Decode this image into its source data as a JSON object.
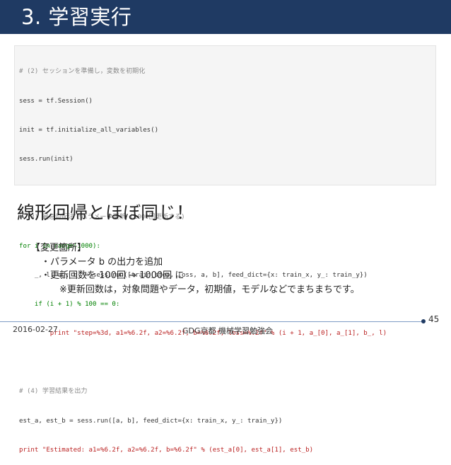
{
  "slide": {
    "title": "3. 学習実行",
    "heading": "線形回帰とほぼ同じ！",
    "notes": [
      "【変更箇所】",
      "・パラメータ b の出力を追加",
      "・更新回数を 100回 → 1000回 に",
      "※更新回数は，対象問題やデータ，初期値，モデルなどでまちまちです。"
    ],
    "footer": {
      "date": "2016-02-27",
      "event": "GDG京都 機械学習勉強会",
      "page": "45"
    }
  },
  "code": {
    "comment1": "# (2) セッションを準備し，変数を初期化",
    "line1": "sess = tf.Session()",
    "line2": "init = tf.initialize_all_variables()",
    "line3": "sess.run(init)",
    "comment2": "# (3) 最急勾配法でパラメータ更新 (1000回更新する)",
    "line4": "for i in range(1000):",
    "line5": "    _, l, a_, b_ = sess.run([train_step, loss, a, b], feed_dict={x: train_x, y_: train_y})",
    "line6": "    if (i + 1) % 100 == 0:",
    "line7": "        print \"step=%3d, a1=%6.2f, a2=%6.2f, b=%6.2f, loss=%.2f\" % (i + 1, a_[0], a_[1], b_, l)",
    "comment3": "# (4) 学習結果を出力",
    "line8": "est_a, est_b = sess.run([a, b], feed_dict={x: train_x, y_: train_y})",
    "line9": "print \"Estimated: a1=%6.2f, a2=%6.2f, b=%6.2f\" % (est_a[0], est_a[1], est_b)"
  },
  "colors": {
    "title_bar": "#1f3a63",
    "comment": "#8a8a8a",
    "keyword": "#008000",
    "string": "#ba2121",
    "code_bg": "#f5f5f5"
  }
}
